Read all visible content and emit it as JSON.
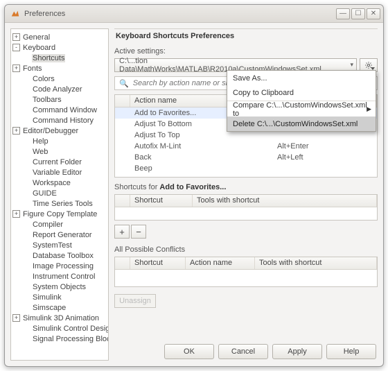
{
  "window": {
    "title": "Preferences"
  },
  "tree": [
    {
      "l": 0,
      "exp": "+",
      "t": "General"
    },
    {
      "l": 0,
      "exp": "-",
      "t": "Keyboard"
    },
    {
      "l": 1,
      "exp": "",
      "t": "Shortcuts",
      "sel": true
    },
    {
      "l": 0,
      "exp": "+",
      "t": "Fonts"
    },
    {
      "l": 1,
      "exp": "",
      "t": "Colors"
    },
    {
      "l": 1,
      "exp": "",
      "t": "Code Analyzer"
    },
    {
      "l": 1,
      "exp": "",
      "t": "Toolbars"
    },
    {
      "l": 1,
      "exp": "",
      "t": "Command Window"
    },
    {
      "l": 1,
      "exp": "",
      "t": "Command History"
    },
    {
      "l": 0,
      "exp": "+",
      "t": "Editor/Debugger"
    },
    {
      "l": 1,
      "exp": "",
      "t": "Help"
    },
    {
      "l": 1,
      "exp": "",
      "t": "Web"
    },
    {
      "l": 1,
      "exp": "",
      "t": "Current Folder"
    },
    {
      "l": 1,
      "exp": "",
      "t": "Variable Editor"
    },
    {
      "l": 1,
      "exp": "",
      "t": "Workspace"
    },
    {
      "l": 1,
      "exp": "",
      "t": "GUIDE"
    },
    {
      "l": 1,
      "exp": "",
      "t": "Time Series Tools"
    },
    {
      "l": 0,
      "exp": "+",
      "t": "Figure Copy Template"
    },
    {
      "l": 1,
      "exp": "",
      "t": "Compiler"
    },
    {
      "l": 1,
      "exp": "",
      "t": "Report Generator"
    },
    {
      "l": 1,
      "exp": "",
      "t": "SystemTest"
    },
    {
      "l": 1,
      "exp": "",
      "t": "Database Toolbox"
    },
    {
      "l": 1,
      "exp": "",
      "t": "Image Processing"
    },
    {
      "l": 1,
      "exp": "",
      "t": "Instrument Control"
    },
    {
      "l": 1,
      "exp": "",
      "t": "System Objects"
    },
    {
      "l": 1,
      "exp": "",
      "t": "Simulink"
    },
    {
      "l": 1,
      "exp": "",
      "t": "Simscape"
    },
    {
      "l": 0,
      "exp": "+",
      "t": "Simulink 3D Animation"
    },
    {
      "l": 1,
      "exp": "",
      "t": "Simulink Control Design"
    },
    {
      "l": 1,
      "exp": "",
      "t": "Signal Processing Blockset"
    }
  ],
  "pane": {
    "title": "Keyboard Shortcuts Preferences",
    "active_label": "Active settings:",
    "active_value": "C:\\...tion Data\\MathWorks\\MATLAB\\R2010a\\CustomWindowsSet.xml",
    "search_placeholder": "Search by action name or shortcut",
    "actions_header": "Action name",
    "actions": [
      {
        "n": "Add to Favorites...",
        "k": "",
        "sel": true
      },
      {
        "n": "Adjust To Bottom",
        "k": ""
      },
      {
        "n": "Adjust To Top",
        "k": ""
      },
      {
        "n": "Autofix M-Lint",
        "k": "Alt+Enter"
      },
      {
        "n": "Back",
        "k": "Alt+Left"
      },
      {
        "n": "Beep",
        "k": ""
      }
    ],
    "shortcuts_prefix": "Shortcuts for ",
    "shortcuts_for": "Add to Favorites...",
    "sc_cols": {
      "shortcut": "Shortcut",
      "tools": "Tools with shortcut"
    },
    "conflicts_label": "All Possible Conflicts",
    "conf_cols": {
      "shortcut": "Shortcut",
      "action": "Action name",
      "tools": "Tools with shortcut"
    },
    "unassign": "Unassign",
    "buttons": {
      "add": "+",
      "remove": "−"
    }
  },
  "menu": {
    "saveas": "Save As...",
    "copy": "Copy to Clipboard",
    "compare": "Compare C:\\...\\CustomWindowsSet.xml to",
    "delete": "Delete C:\\...\\CustomWindowsSet.xml"
  },
  "footer": {
    "ok": "OK",
    "cancel": "Cancel",
    "apply": "Apply",
    "help": "Help"
  }
}
